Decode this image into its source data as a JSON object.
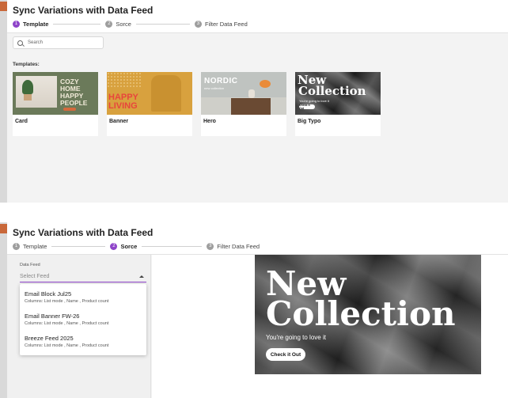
{
  "dialog": {
    "title": "Sync Variations with Data Feed"
  },
  "steps": [
    {
      "num": "1",
      "label": "Template"
    },
    {
      "num": "2",
      "label": "Sorce"
    },
    {
      "num": "3",
      "label": "Filter Data Feed"
    }
  ],
  "panel1": {
    "active_step": 1,
    "search": {
      "placeholder": "Search"
    },
    "templates_label": "Templates:",
    "templates": [
      {
        "name": "Card",
        "thumb_text": "COZY HOME HAPPY PEOPLE"
      },
      {
        "name": "Banner",
        "thumb_text": "HAPPY LIVING"
      },
      {
        "name": "Hero",
        "thumb_text": "NORDIC",
        "thumb_sub": "new collection"
      },
      {
        "name": "Big Typo",
        "thumb_line1": "New",
        "thumb_line2": "Collection",
        "thumb_sub": "You're going to love it",
        "thumb_button": "Check it Out"
      }
    ]
  },
  "panel2": {
    "active_step": 2,
    "feed_label": "Data Feed",
    "feed_placeholder": "Select Feed",
    "feeds": [
      {
        "name": "Email Block Jul25",
        "columns": "Columns: List mode , Name , Product count"
      },
      {
        "name": "Email Banner FW-26",
        "columns": "Columns: List mode , Name , Product count"
      },
      {
        "name": "Breeze Feed 2025",
        "columns": "Columns: List mode , Name , Product count"
      }
    ],
    "preview": {
      "line1": "New",
      "line2": "Collection",
      "subtitle": "You're going to love it",
      "button": "Check it Out"
    }
  },
  "colors": {
    "accent": "#8e44c9",
    "step_inactive": "#9e9e9e",
    "content_bg": "#f3f3f3"
  }
}
